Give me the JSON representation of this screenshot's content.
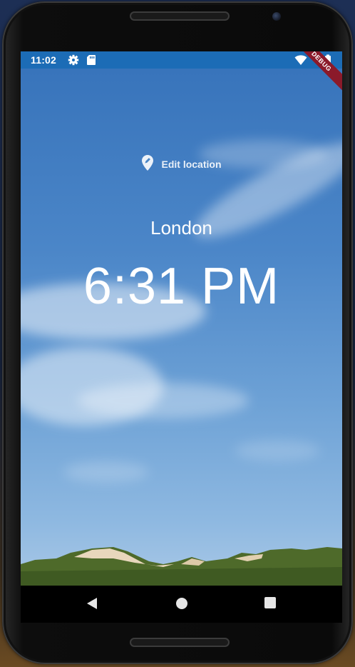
{
  "status_bar": {
    "time": "11:02",
    "icons": [
      "settings-icon",
      "sd-card-icon",
      "wifi-icon",
      "battery-icon"
    ],
    "background": "#1c6cb6"
  },
  "debug_banner": {
    "label": "DEBUG",
    "color": "#8b1a2a"
  },
  "edit_location": {
    "icon": "location-pin-icon",
    "label": "Edit location"
  },
  "location_name": "London",
  "current_time": "6:31 PM",
  "navigation_bar": {
    "buttons": [
      "back-icon",
      "home-icon",
      "recents-icon"
    ]
  }
}
